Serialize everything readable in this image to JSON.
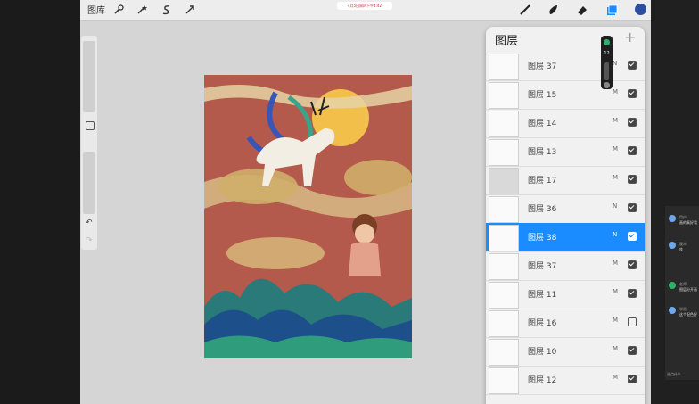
{
  "toolbar": {
    "gallery_label": "图库",
    "status_text": "4月5日周四下午4:42",
    "tools": [
      "wrench-icon",
      "magic-wand-icon",
      "selection-s-icon",
      "transform-arrow-icon"
    ],
    "right_tools": [
      "brush-icon",
      "smudge-icon",
      "eraser-icon",
      "layers-icon"
    ],
    "color": "#2c4e9c"
  },
  "sidebar": {
    "undo_glyph": "↶",
    "redo_glyph": "↷"
  },
  "layers_panel": {
    "title": "图层",
    "add_glyph": "+",
    "layers": [
      {
        "name": "图层 37",
        "mode": "N",
        "visible": true
      },
      {
        "name": "图层 15",
        "mode": "M",
        "visible": true
      },
      {
        "name": "图层 14",
        "mode": "M",
        "visible": true
      },
      {
        "name": "图层 13",
        "mode": "M",
        "visible": true
      },
      {
        "name": "图层 17",
        "mode": "M",
        "visible": true
      },
      {
        "name": "图层 36",
        "mode": "N",
        "visible": true
      },
      {
        "name": "图层 38",
        "mode": "N",
        "visible": true,
        "selected": true
      },
      {
        "name": "图层 37",
        "mode": "M",
        "visible": true
      },
      {
        "name": "图层 11",
        "mode": "M",
        "visible": true
      },
      {
        "name": "图层 16",
        "mode": "M",
        "visible": false
      },
      {
        "name": "图层 10",
        "mode": "M",
        "visible": true
      },
      {
        "name": "图层 12",
        "mode": "M",
        "visible": true
      }
    ]
  },
  "mini_control": {
    "value": "12"
  },
  "chat": {
    "messages": [
      {
        "name": "用户",
        "text": "画的真好看"
      },
      {
        "name": "观众",
        "text": "哇"
      },
      {
        "name": "老师",
        "text": "图层分开画"
      },
      {
        "name": "学员",
        "text": "这个配色好"
      }
    ],
    "bottom": "说点什么..."
  }
}
